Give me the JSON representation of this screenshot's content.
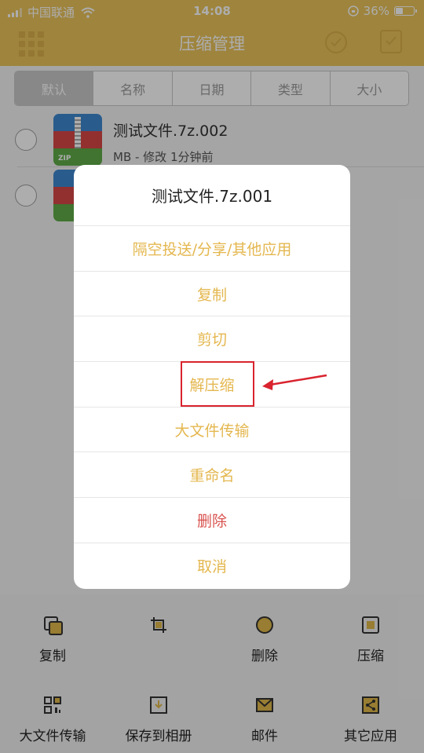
{
  "status_bar": {
    "carrier": "中国联通",
    "time": "14:08",
    "battery": "36%",
    "battery_level": 0.36
  },
  "nav": {
    "title": "压缩管理"
  },
  "sort_tabs": [
    {
      "label": "默认",
      "active": true
    },
    {
      "label": "名称",
      "active": false
    },
    {
      "label": "日期",
      "active": false
    },
    {
      "label": "类型",
      "active": false
    },
    {
      "label": "大小",
      "active": false
    }
  ],
  "files": [
    {
      "name": "测试文件.7z.002",
      "meta": "MB - 修改 1分钟前",
      "icon_tag": "ZIP"
    },
    {
      "name": "",
      "meta": "",
      "icon_tag": ""
    }
  ],
  "action_sheet": {
    "title": "测试文件.7z.001",
    "items": [
      {
        "label": "隔空投送/分享/其他应用"
      },
      {
        "label": "复制"
      },
      {
        "label": "剪切"
      },
      {
        "label": "解压缩"
      },
      {
        "label": "大文件传输"
      },
      {
        "label": "重命名"
      },
      {
        "label": "删除",
        "danger": true
      },
      {
        "label": "取消"
      }
    ]
  },
  "toolbar": {
    "copy": "复制",
    "crop": "",
    "delete": "删除",
    "compress": "压缩",
    "big_transfer": "大文件传输",
    "save_album": "保存到相册",
    "mail": "邮件",
    "other_apps": "其它应用"
  },
  "colors": {
    "accent": "#e9c35a",
    "sheet_text": "#e4b74f",
    "danger": "#d9534f",
    "annotation": "#d9232e"
  }
}
